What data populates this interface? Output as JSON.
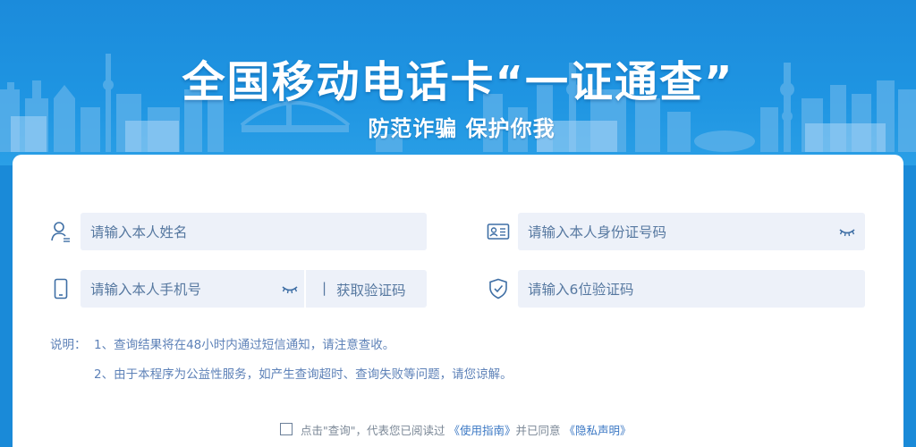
{
  "banner": {
    "title": "全国移动电话卡“一证通查”",
    "subtitle": "防范诈骗 保护你我"
  },
  "form": {
    "name_placeholder": "请输入本人姓名",
    "id_placeholder": "请输入本人身份证号码",
    "phone_placeholder": "请输入本人手机号",
    "code_separator": "|",
    "get_code_label": "获取验证码",
    "code_placeholder": "请输入6位验证码"
  },
  "notes": {
    "label": "说明：",
    "item1": "1、查询结果将在48小时内通过短信通知，请注意查收。",
    "item2": "2、由于本程序为公益性服务，如产生查询超时、查询失败等问题，请您谅解。"
  },
  "agreement": {
    "prefix": "点击\"查询\"，代表您已阅读过",
    "guide_link": "《使用指南》",
    "middle": "并已同意",
    "privacy_link": "《隐私声明》"
  },
  "colors": {
    "banner_blue": "#1b8bdb",
    "field_bg": "#edf1f9",
    "text_blue": "#5678a0",
    "link_blue": "#3b78c4"
  }
}
